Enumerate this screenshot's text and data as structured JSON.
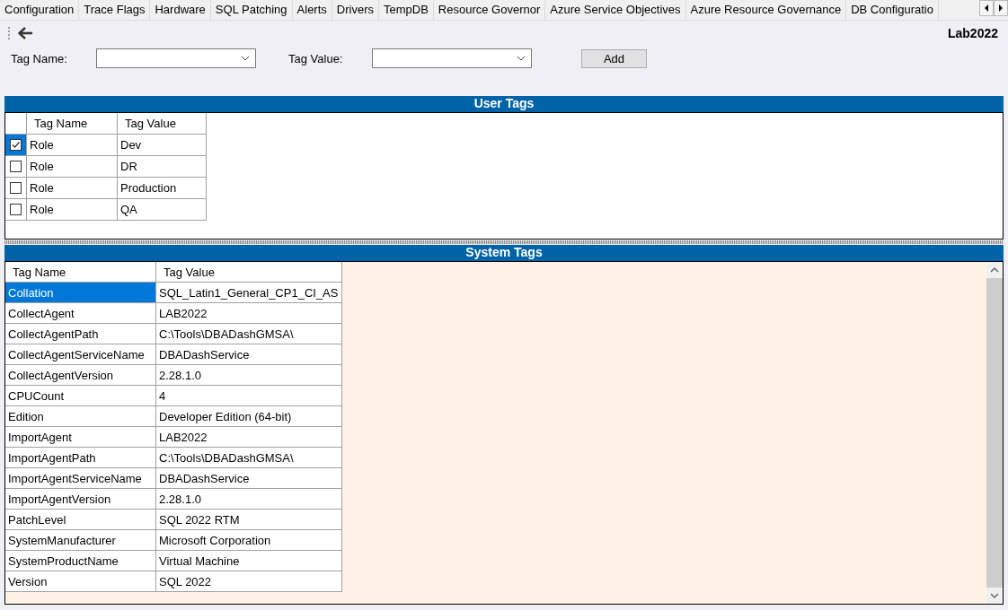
{
  "tabs": [
    "Configuration",
    "Trace Flags",
    "Hardware",
    "SQL Patching",
    "Alerts",
    "Drivers",
    "TempDB",
    "Resource Governor",
    "Azure Service Objectives",
    "Azure Resource Governance",
    "DB Configuratio"
  ],
  "instance": "Lab2022",
  "filters": {
    "tag_name_label": "Tag Name:",
    "tag_value_label": "Tag Value:",
    "add_button": "Add"
  },
  "user_tags": {
    "title": "User Tags",
    "columns": [
      "Tag Name",
      "Tag Value"
    ],
    "rows": [
      {
        "name": "Role",
        "value": "Dev",
        "checked": true,
        "selected": true
      },
      {
        "name": "Role",
        "value": "DR",
        "checked": false,
        "selected": false
      },
      {
        "name": "Role",
        "value": "Production",
        "checked": false,
        "selected": false
      },
      {
        "name": "Role",
        "value": "QA",
        "checked": false,
        "selected": false
      }
    ]
  },
  "system_tags": {
    "title": "System Tags",
    "columns": [
      "Tag Name",
      "Tag Value"
    ],
    "rows": [
      {
        "name": "Collation",
        "value": "SQL_Latin1_General_CP1_CI_AS",
        "selected": true
      },
      {
        "name": "CollectAgent",
        "value": "LAB2022",
        "selected": false
      },
      {
        "name": "CollectAgentPath",
        "value": "C:\\Tools\\DBADashGMSA\\",
        "selected": false
      },
      {
        "name": "CollectAgentServiceName",
        "value": "DBADashService",
        "selected": false
      },
      {
        "name": "CollectAgentVersion",
        "value": "2.28.1.0",
        "selected": false
      },
      {
        "name": "CPUCount",
        "value": "4",
        "selected": false
      },
      {
        "name": "Edition",
        "value": "Developer Edition (64-bit)",
        "selected": false
      },
      {
        "name": "ImportAgent",
        "value": "LAB2022",
        "selected": false
      },
      {
        "name": "ImportAgentPath",
        "value": "C:\\Tools\\DBADashGMSA\\",
        "selected": false
      },
      {
        "name": "ImportAgentServiceName",
        "value": "DBADashService",
        "selected": false
      },
      {
        "name": "ImportAgentVersion",
        "value": "2.28.1.0",
        "selected": false
      },
      {
        "name": "PatchLevel",
        "value": "SQL 2022 RTM",
        "selected": false
      },
      {
        "name": "SystemManufacturer",
        "value": "Microsoft Corporation",
        "selected": false
      },
      {
        "name": "SystemProductName",
        "value": "Virtual Machine",
        "selected": false
      },
      {
        "name": "Version",
        "value": "SQL 2022",
        "selected": false
      }
    ]
  }
}
